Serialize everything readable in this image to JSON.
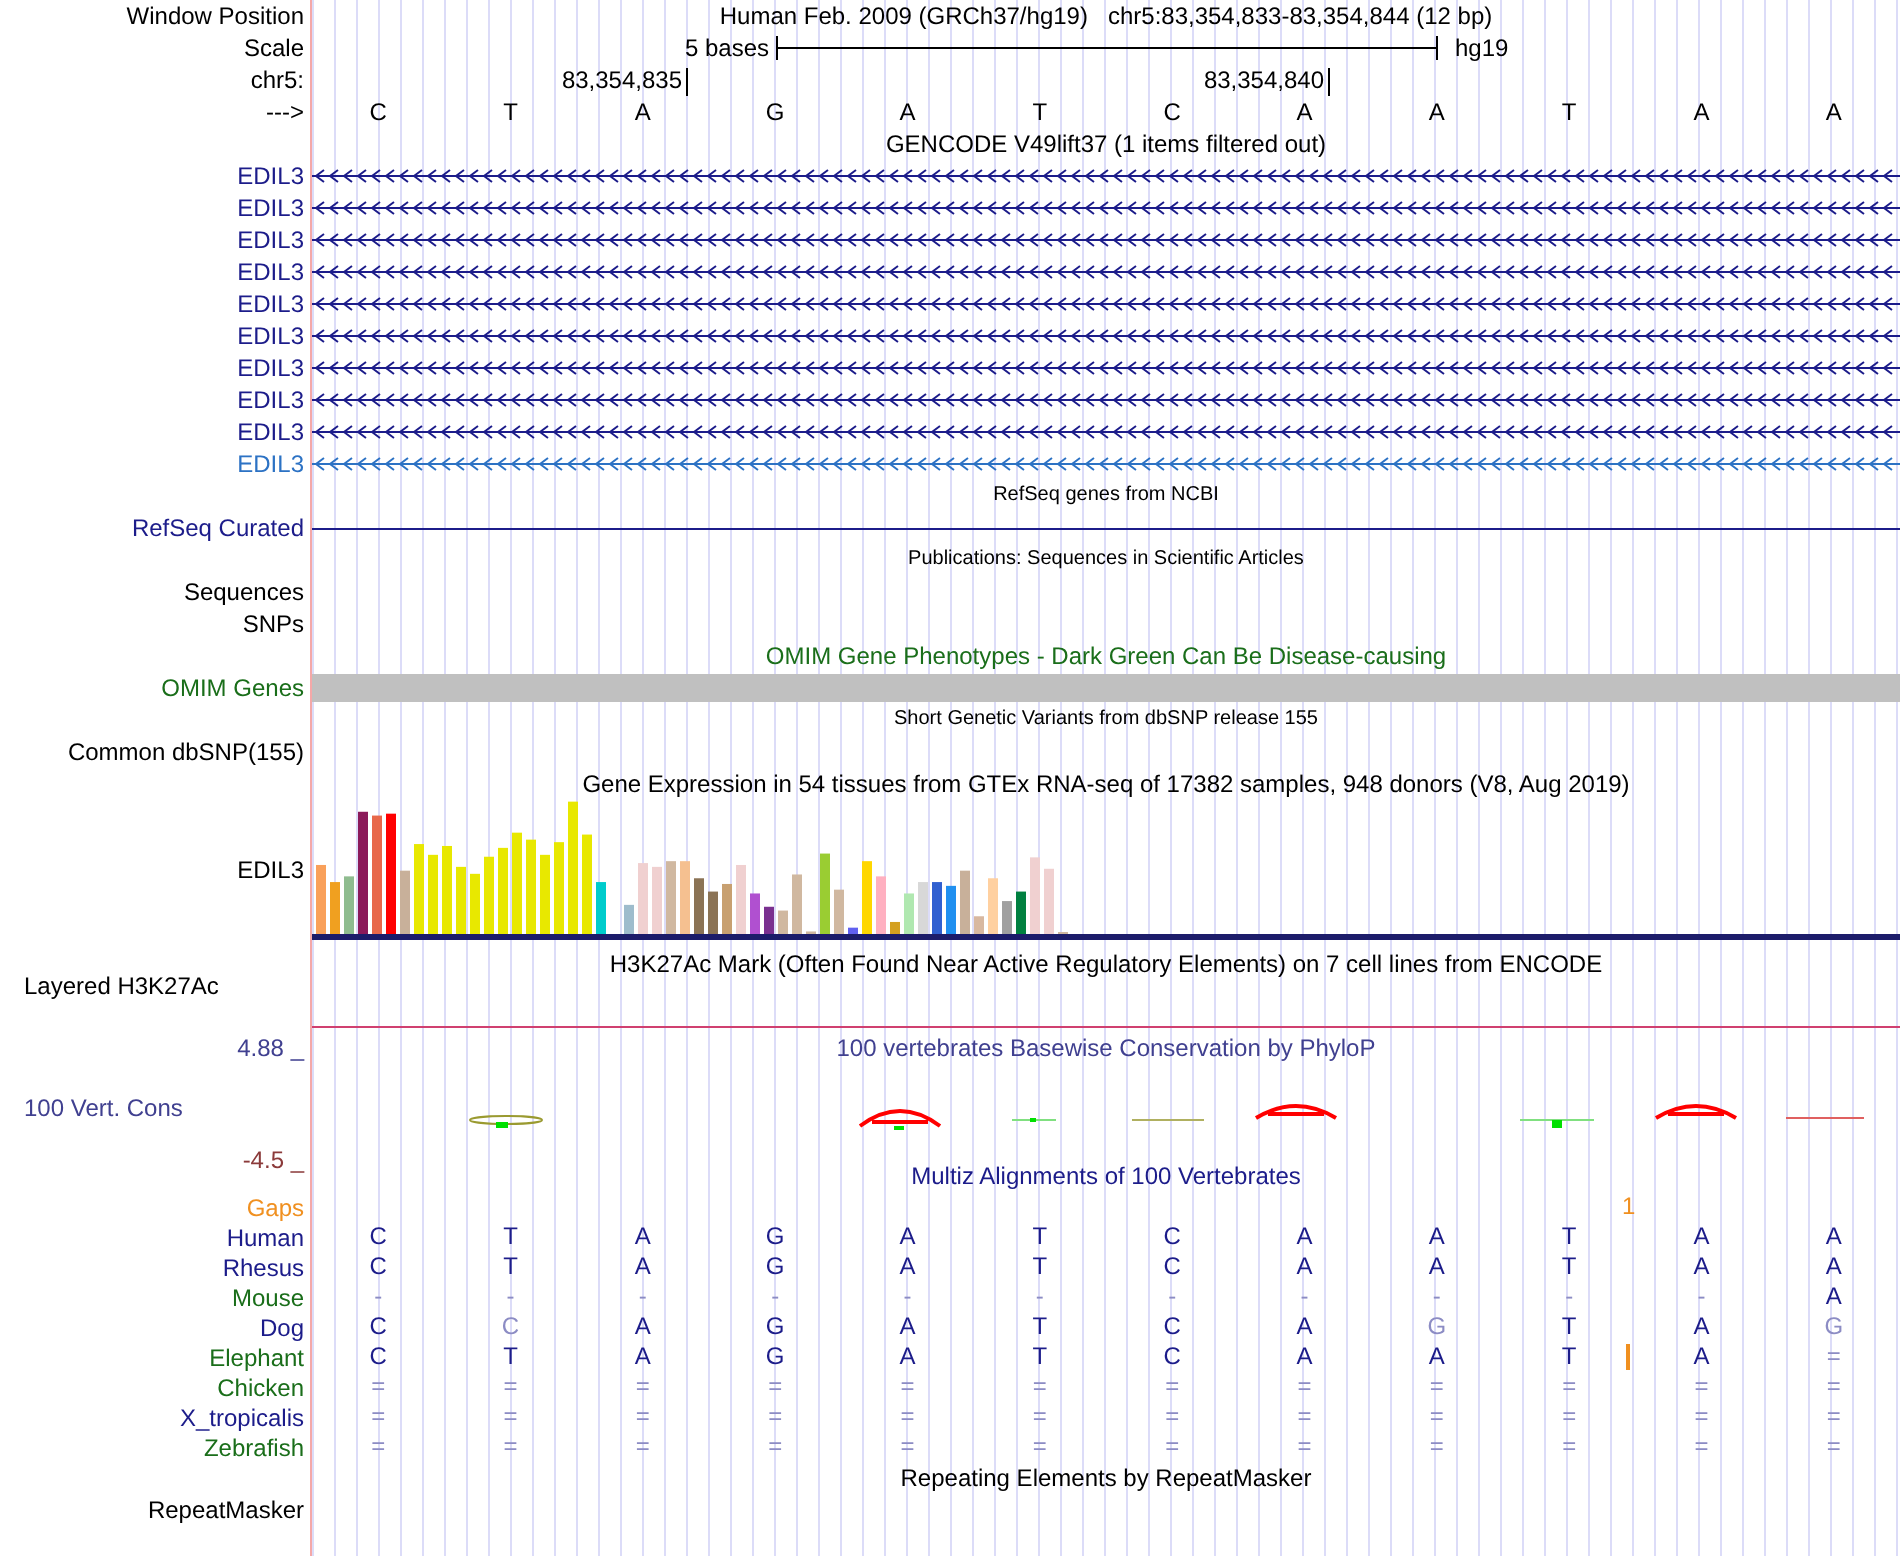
{
  "header": {
    "window_position_label": "Window Position",
    "assembly": "Human Feb. 2009 (GRCh37/hg19)",
    "position": "chr5:83,354,833-83,354,844 (12 bp)",
    "scale_label": "Scale",
    "scale_text": "5 bases",
    "scale_db": "hg19",
    "chrom_label": "chr5:",
    "ticks": [
      "83,354,835",
      "83,354,840"
    ],
    "strand_label": "--->",
    "bases": [
      "C",
      "T",
      "A",
      "G",
      "A",
      "T",
      "C",
      "A",
      "A",
      "T",
      "A",
      "A"
    ]
  },
  "gencode": {
    "title": "GENCODE V49lift37 (1 items filtered out)",
    "genes": [
      {
        "name": "EDIL3",
        "color": "#1c1c8a"
      },
      {
        "name": "EDIL3",
        "color": "#1c1c8a"
      },
      {
        "name": "EDIL3",
        "color": "#1c1c8a"
      },
      {
        "name": "EDIL3",
        "color": "#1c1c8a"
      },
      {
        "name": "EDIL3",
        "color": "#1c1c8a"
      },
      {
        "name": "EDIL3",
        "color": "#1c1c8a"
      },
      {
        "name": "EDIL3",
        "color": "#1c1c8a"
      },
      {
        "name": "EDIL3",
        "color": "#1c1c8a"
      },
      {
        "name": "EDIL3",
        "color": "#1c1c8a"
      },
      {
        "name": "EDIL3",
        "color": "#2c72c4"
      }
    ]
  },
  "refseq": {
    "title": "RefSeq genes from NCBI",
    "label": "RefSeq Curated"
  },
  "publications": {
    "title": "Publications: Sequences in Scientific Articles",
    "labels": [
      "Sequences",
      "SNPs"
    ]
  },
  "omim": {
    "title": "OMIM Gene Phenotypes - Dark Green Can Be Disease-causing",
    "label": "OMIM Genes"
  },
  "dbsnp": {
    "title": "Short Genetic Variants from dbSNP release 155",
    "label": "Common dbSNP(155)"
  },
  "gtex": {
    "title": "Gene Expression in 54 tissues from GTEx RNA-seq of 17382 samples, 948 donors (V8, Aug 2019)",
    "label": "EDIL3"
  },
  "h3k27ac": {
    "title": "H3K27Ac Mark (Often Found Near Active Regulatory Elements) on 7 cell lines from ENCODE",
    "label": "Layered H3K27Ac"
  },
  "phylop": {
    "title": "100 vertebrates Basewise Conservation by PhyloP",
    "label": "100 Vert. Cons",
    "max": "4.88 _",
    "min": "-4.5 _"
  },
  "multiz": {
    "title": "Multiz Alignments of 100 Vertebrates",
    "gaps_label": "Gaps",
    "gap_mark": "1",
    "species": [
      {
        "name": "Human",
        "color": "#1c1c8a",
        "insertion": false,
        "bases": [
          {
            "text": "C",
            "faded": false
          },
          {
            "text": "T",
            "faded": false
          },
          {
            "text": "A",
            "faded": false
          },
          {
            "text": "G",
            "faded": false
          },
          {
            "text": "A",
            "faded": false
          },
          {
            "text": "T",
            "faded": false
          },
          {
            "text": "C",
            "faded": false
          },
          {
            "text": "A",
            "faded": false
          },
          {
            "text": "A",
            "faded": false
          },
          {
            "text": "T",
            "faded": false
          },
          {
            "text": "A",
            "faded": false
          },
          {
            "text": "A",
            "faded": false
          }
        ]
      },
      {
        "name": "Rhesus",
        "color": "#1c1c8a",
        "insertion": false,
        "bases": [
          {
            "text": "C",
            "faded": false
          },
          {
            "text": "T",
            "faded": false
          },
          {
            "text": "A",
            "faded": false
          },
          {
            "text": "G",
            "faded": false
          },
          {
            "text": "A",
            "faded": false
          },
          {
            "text": "T",
            "faded": false
          },
          {
            "text": "C",
            "faded": false
          },
          {
            "text": "A",
            "faded": false
          },
          {
            "text": "A",
            "faded": false
          },
          {
            "text": "T",
            "faded": false
          },
          {
            "text": "A",
            "faded": false
          },
          {
            "text": "A",
            "faded": false
          }
        ]
      },
      {
        "name": "Mouse",
        "color": "#1a6e1a",
        "insertion": false,
        "bases": [
          {
            "text": "-",
            "faded": true
          },
          {
            "text": "-",
            "faded": true
          },
          {
            "text": "-",
            "faded": true
          },
          {
            "text": "-",
            "faded": true
          },
          {
            "text": "-",
            "faded": true
          },
          {
            "text": "-",
            "faded": true
          },
          {
            "text": "-",
            "faded": true
          },
          {
            "text": "-",
            "faded": true
          },
          {
            "text": "-",
            "faded": true
          },
          {
            "text": "-",
            "faded": true
          },
          {
            "text": "-",
            "faded": true
          },
          {
            "text": "A",
            "faded": false
          }
        ]
      },
      {
        "name": "Dog",
        "color": "#1c1c8a",
        "insertion": false,
        "bases": [
          {
            "text": "C",
            "faded": false
          },
          {
            "text": "C",
            "faded": true
          },
          {
            "text": "A",
            "faded": false
          },
          {
            "text": "G",
            "faded": false
          },
          {
            "text": "A",
            "faded": false
          },
          {
            "text": "T",
            "faded": false
          },
          {
            "text": "C",
            "faded": false
          },
          {
            "text": "A",
            "faded": false
          },
          {
            "text": "G",
            "faded": true
          },
          {
            "text": "T",
            "faded": false
          },
          {
            "text": "A",
            "faded": false
          },
          {
            "text": "G",
            "faded": true
          }
        ]
      },
      {
        "name": "Elephant",
        "color": "#1a6e1a",
        "insertion": true,
        "bases": [
          {
            "text": "C",
            "faded": false
          },
          {
            "text": "T",
            "faded": false
          },
          {
            "text": "A",
            "faded": false
          },
          {
            "text": "G",
            "faded": false
          },
          {
            "text": "A",
            "faded": false
          },
          {
            "text": "T",
            "faded": false
          },
          {
            "text": "C",
            "faded": false
          },
          {
            "text": "A",
            "faded": false
          },
          {
            "text": "A",
            "faded": false
          },
          {
            "text": "T",
            "faded": false
          },
          {
            "text": "A",
            "faded": false
          },
          {
            "text": "=",
            "faded": true
          }
        ]
      },
      {
        "name": "Chicken",
        "color": "#1a6e1a",
        "insertion": false,
        "bases": [
          {
            "text": "=",
            "faded": true
          },
          {
            "text": "=",
            "faded": true
          },
          {
            "text": "=",
            "faded": true
          },
          {
            "text": "=",
            "faded": true
          },
          {
            "text": "=",
            "faded": true
          },
          {
            "text": "=",
            "faded": true
          },
          {
            "text": "=",
            "faded": true
          },
          {
            "text": "=",
            "faded": true
          },
          {
            "text": "=",
            "faded": true
          },
          {
            "text": "=",
            "faded": true
          },
          {
            "text": "=",
            "faded": true
          },
          {
            "text": "=",
            "faded": true
          }
        ]
      },
      {
        "name": "X_tropicalis",
        "color": "#1c1c8a",
        "insertion": false,
        "bases": [
          {
            "text": "=",
            "faded": true
          },
          {
            "text": "=",
            "faded": true
          },
          {
            "text": "=",
            "faded": true
          },
          {
            "text": "=",
            "faded": true
          },
          {
            "text": "=",
            "faded": true
          },
          {
            "text": "=",
            "faded": true
          },
          {
            "text": "=",
            "faded": true
          },
          {
            "text": "=",
            "faded": true
          },
          {
            "text": "=",
            "faded": true
          },
          {
            "text": "=",
            "faded": true
          },
          {
            "text": "=",
            "faded": true
          },
          {
            "text": "=",
            "faded": true
          }
        ]
      },
      {
        "name": "Zebrafish",
        "color": "#1a6e1a",
        "insertion": false,
        "bases": [
          {
            "text": "=",
            "faded": true
          },
          {
            "text": "=",
            "faded": true
          },
          {
            "text": "=",
            "faded": true
          },
          {
            "text": "=",
            "faded": true
          },
          {
            "text": "=",
            "faded": true
          },
          {
            "text": "=",
            "faded": true
          },
          {
            "text": "=",
            "faded": true
          },
          {
            "text": "=",
            "faded": true
          },
          {
            "text": "=",
            "faded": true
          },
          {
            "text": "=",
            "faded": true
          },
          {
            "text": "=",
            "faded": true
          },
          {
            "text": "=",
            "faded": true
          }
        ]
      }
    ]
  },
  "repeatmasker": {
    "title": "Repeating Elements by RepeatMasker",
    "label": "RepeatMasker"
  }
}
